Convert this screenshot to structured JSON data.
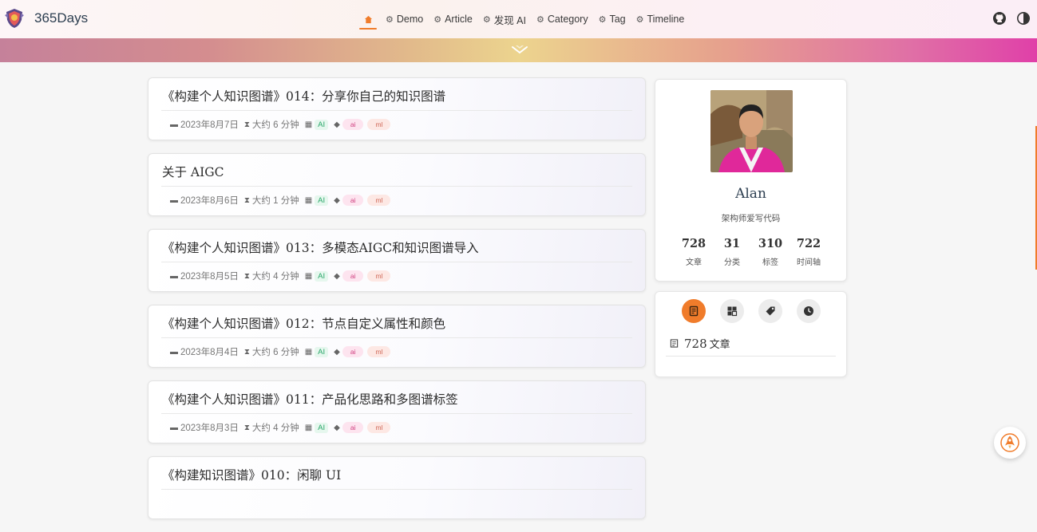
{
  "header": {
    "brand": "365Days",
    "nav": [
      {
        "label": "Demo",
        "icon": "tag-icon"
      },
      {
        "label": "Article",
        "icon": "tag-icon"
      },
      {
        "label": "发现 AI",
        "icon": "tag-icon"
      },
      {
        "label": "Category",
        "icon": "tag-icon"
      },
      {
        "label": "Tag",
        "icon": "tag-icon"
      },
      {
        "label": "Timeline",
        "icon": "tag-icon"
      }
    ]
  },
  "posts": [
    {
      "title": "《构建个人知识图谱》014：分享你自己的知识图谱",
      "date": "2023年8月7日",
      "read_time": "大约 6 分钟",
      "category": "AI",
      "tags": [
        "ai",
        "ml"
      ]
    },
    {
      "title": "关于 AIGC",
      "date": "2023年8月6日",
      "read_time": "大约 1 分钟",
      "category": "AI",
      "tags": [
        "ai",
        "ml"
      ]
    },
    {
      "title": "《构建个人知识图谱》013：多模态AIGC和知识图谱导入",
      "date": "2023年8月5日",
      "read_time": "大约 4 分钟",
      "category": "AI",
      "tags": [
        "ai",
        "ml"
      ]
    },
    {
      "title": "《构建个人知识图谱》012：节点自定义属性和颜色",
      "date": "2023年8月4日",
      "read_time": "大约 6 分钟",
      "category": "AI",
      "tags": [
        "ai",
        "ml"
      ]
    },
    {
      "title": "《构建个人知识图谱》011：产品化思路和多图谱标签",
      "date": "2023年8月3日",
      "read_time": "大约 4 分钟",
      "category": "AI",
      "tags": [
        "ai",
        "ml"
      ]
    },
    {
      "title": "《构建知识图谱》010：闲聊 UI",
      "date": "",
      "read_time": "",
      "category": "",
      "tags": []
    }
  ],
  "profile": {
    "name": "Alan",
    "motto": "架构师爱写代码",
    "stats": [
      {
        "num": "728",
        "label": "文章"
      },
      {
        "num": "31",
        "label": "分类"
      },
      {
        "num": "310",
        "label": "标签"
      },
      {
        "num": "722",
        "label": "时间轴"
      }
    ]
  },
  "tab_panel": {
    "count": "728",
    "label": "文章"
  },
  "colors": {
    "accent": "#f07c2b"
  }
}
